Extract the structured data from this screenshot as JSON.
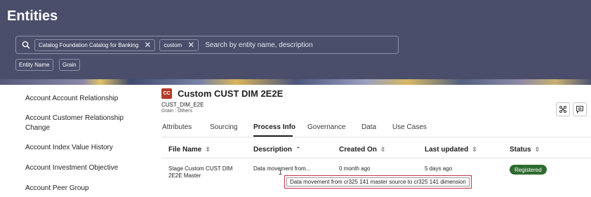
{
  "header": {
    "title": "Entities",
    "search": {
      "chips": [
        {
          "label": "Catalog Foundation Catalog for Banking"
        },
        {
          "label": "custom"
        }
      ],
      "placeholder": "Search by entity name, description"
    },
    "filters": [
      "Entity Name",
      "Grain"
    ]
  },
  "sidebar": {
    "items": [
      "Account Account Relationship",
      "Account Customer Relationship Change",
      "Account Index Value History",
      "Account Investment Objective",
      "Account Peer Group"
    ]
  },
  "entity": {
    "badge": "CC",
    "title": "Custom CUST DIM 2E2E",
    "code": "CUST_DIM_E2E",
    "grain": "Grain : Others"
  },
  "tabs": [
    "Attributes",
    "Sourcing",
    "Process Info",
    "Governance",
    "Data",
    "Use Cases"
  ],
  "active_tab": "Process Info",
  "table": {
    "columns": [
      {
        "label": "File Name",
        "sort": "⇳"
      },
      {
        "label": "Description",
        "sort": "⌃"
      },
      {
        "label": "Created On",
        "sort": "⇳"
      },
      {
        "label": "Last updated",
        "sort": "⇳"
      },
      {
        "label": "Status",
        "sort": "⇳"
      }
    ],
    "rows": [
      {
        "file_name_line1": "Stage Custom CUST DIM",
        "file_name_line2": "2E2E Master",
        "description": "Data movement from...",
        "created_on": "0 month ago",
        "last_updated": "5 days ago",
        "status": "Registered"
      }
    ]
  },
  "tooltip": "Data movement from cr325 141 master source to cr325 141 dimension",
  "colors": {
    "header_bg": "#4a4e6a",
    "badge": "#b43a2a",
    "status_ok": "#2e6b2e",
    "tooltip_border": "#c8324a"
  },
  "icons": [
    "search-icon",
    "close-icon",
    "network-icon",
    "comment-icon",
    "text-cursor-icon"
  ]
}
